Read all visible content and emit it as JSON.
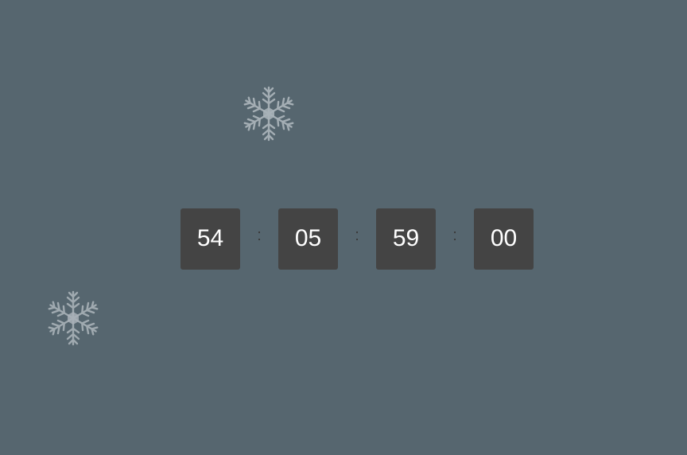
{
  "countdown": {
    "units": [
      "54",
      "05",
      "59",
      "00"
    ],
    "separator": ":"
  },
  "decor": {
    "flake_icon": "snowflake-icon",
    "flake_color": "#a9b2b8",
    "background": "#56666f",
    "box_color": "#444444"
  }
}
